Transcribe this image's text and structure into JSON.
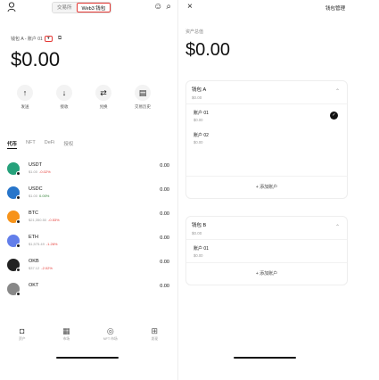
{
  "left": {
    "segment": {
      "exchange": "交易所",
      "web3": "Web3 钱包"
    },
    "wallet_label": "钱包 A - 账户 01",
    "wallet_dd": "▾",
    "copy_icon": "⧉",
    "balance": "$0.00",
    "actions": [
      {
        "icon": "↑",
        "label": "发送"
      },
      {
        "icon": "↓",
        "label": "接收"
      },
      {
        "icon": "⇄",
        "label": "兑换"
      },
      {
        "icon": "▤",
        "label": "交易历史"
      }
    ],
    "tabs": [
      "代币",
      "NFT",
      "DeFi",
      "授权"
    ],
    "tokens": [
      {
        "symbol": "USDT",
        "price": "$1.00",
        "change": "-0.02%",
        "up": false,
        "amount": "0.00",
        "color": "#26a17b"
      },
      {
        "symbol": "USDC",
        "price": "$1.00",
        "change": "0.00%",
        "up": true,
        "amount": "0.00",
        "color": "#2775ca"
      },
      {
        "symbol": "BTC",
        "price": "$21,350.50",
        "change": "-0.53%",
        "up": false,
        "amount": "0.00",
        "color": "#f7931a"
      },
      {
        "symbol": "ETH",
        "price": "$1,575.49",
        "change": "-1.26%",
        "up": false,
        "amount": "0.00",
        "color": "#627eea"
      },
      {
        "symbol": "OKB",
        "price": "$37.12",
        "change": "-2.02%",
        "up": false,
        "amount": "0.00",
        "color": "#222222"
      },
      {
        "symbol": "OKT",
        "price": "",
        "change": "",
        "up": false,
        "amount": "0.00",
        "color": "#888888"
      }
    ],
    "nav": [
      {
        "icon": "◘",
        "label": "资产"
      },
      {
        "icon": "▦",
        "label": "市场"
      },
      {
        "icon": "◎",
        "label": "NFT 市场"
      },
      {
        "icon": "⊞",
        "label": "发现"
      }
    ]
  },
  "right": {
    "close_icon": "×",
    "manage": "钱包管理",
    "asset_label": "资产总值",
    "balance": "$0.00",
    "groups": [
      {
        "name": "钱包 A",
        "value": "$0.00",
        "accounts": [
          {
            "name": "账户 01",
            "value": "$0.00",
            "selected": true
          },
          {
            "name": "账户 02",
            "value": "$0.00",
            "selected": false
          }
        ],
        "add": "+ 添加账户"
      },
      {
        "name": "钱包 B",
        "value": "$0.00",
        "accounts": [
          {
            "name": "账户 01",
            "value": "$0.00",
            "selected": false
          }
        ],
        "add": "+ 添加账户"
      }
    ]
  }
}
